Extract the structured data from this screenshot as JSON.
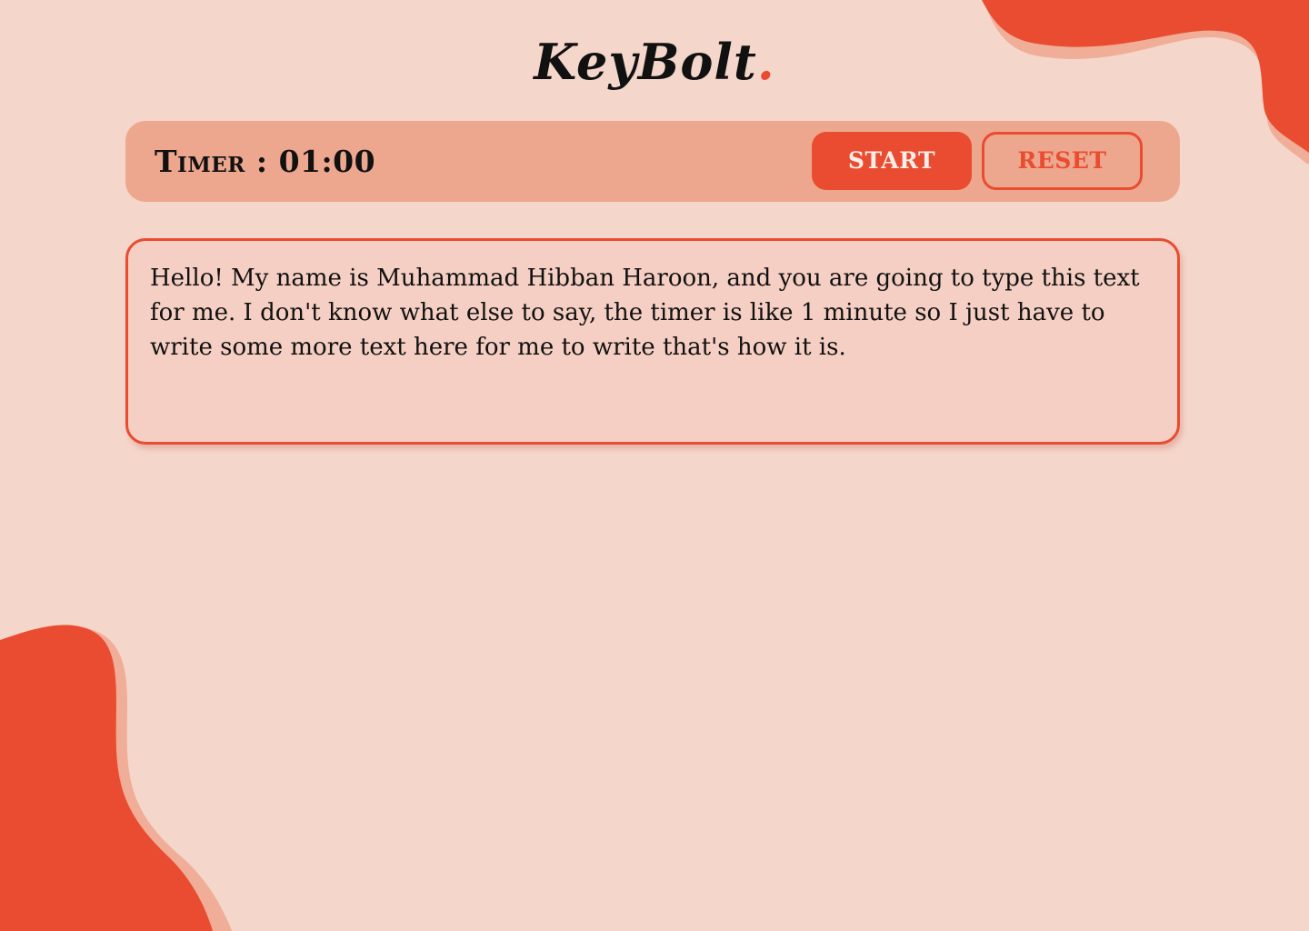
{
  "logo": {
    "name": "KeyBolt",
    "dot": "."
  },
  "timer": {
    "label": "Timer : 01:00"
  },
  "controls": {
    "start_label": "START",
    "reset_label": "RESET"
  },
  "typing": {
    "text": "Hello! My name is Muhammad Hibban Haroon, and you are going to type this text for me. I don't know what else to say, the timer is like 1 minute so I just have to write some more text here for me to write that's how it is."
  },
  "colors": {
    "background": "#f5d6cb",
    "accent": "#e94c30",
    "timer_bar": "#eea78f",
    "text_box": "#f5cfc3"
  }
}
